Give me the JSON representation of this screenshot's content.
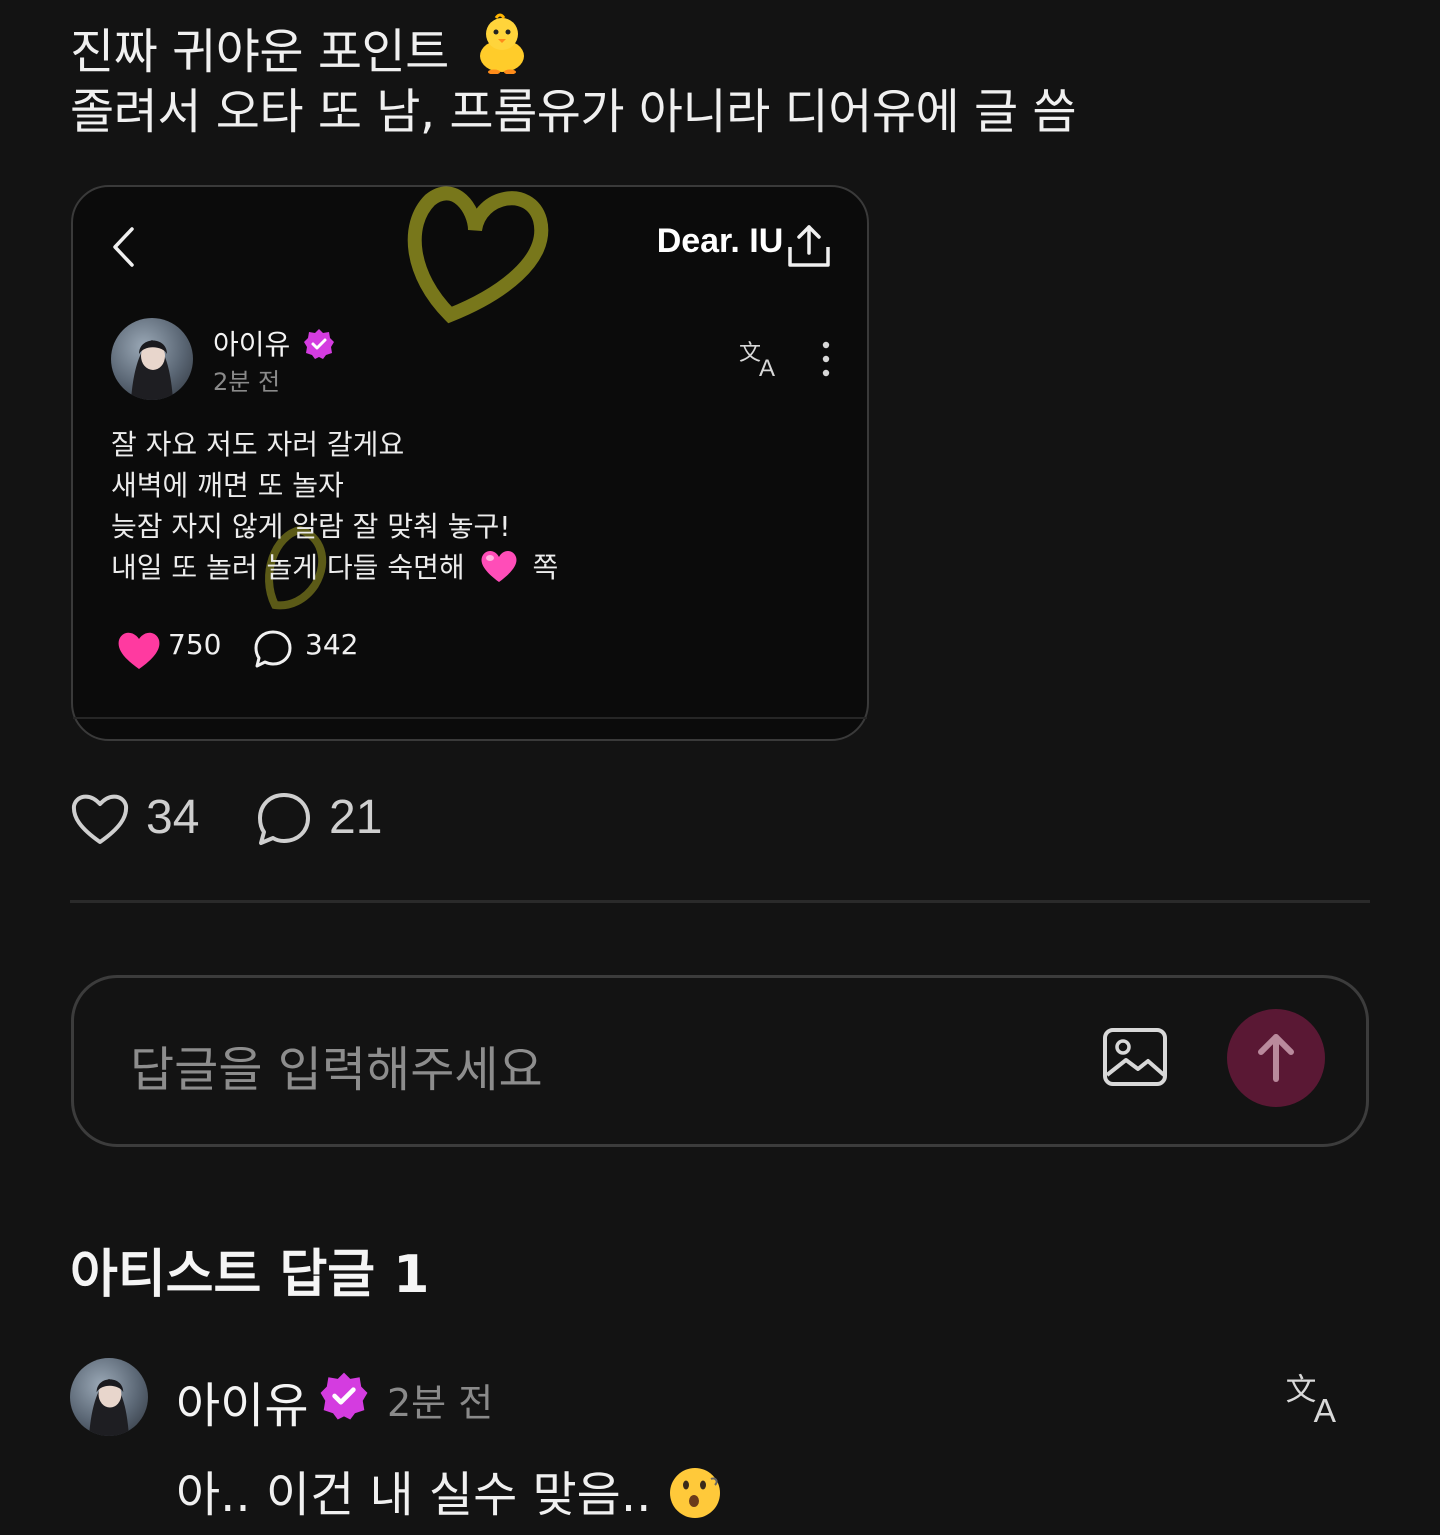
{
  "post": {
    "line1": "진짜 귀야운 포인트",
    "line2": "졸려서 오타 또 남, 프롬유가 아니라 디어유에 글 씀"
  },
  "card": {
    "title": "Dear. IU",
    "author": "아이유",
    "time": "2분 전",
    "body": [
      "잘 자요 저도 자러 갈게요",
      "새벽에 깨면 또 놀자",
      "늦잠 자지 않게 알람 잘 맞춰 놓구!",
      "내일 또 놀러 놀게 다들 숙면해"
    ],
    "body_suffix": "쪽",
    "likes": "750",
    "comments": "342"
  },
  "stats": {
    "likes": "34",
    "comments": "21"
  },
  "reply_input": {
    "placeholder": "답글을 입력해주세요"
  },
  "artist_replies": {
    "title": "아티스트 답글 1",
    "items": [
      {
        "author": "아이유",
        "time": "2분 전",
        "text": "아.. 이건 내 실수 맞음.."
      }
    ]
  },
  "colors": {
    "background": "#131313",
    "verified_badge": "#d43ce0",
    "heart": "#ff3aa0",
    "send_button": "#5a1834",
    "doodle": "#d4d22a"
  },
  "icons": {
    "back": "chevron-left-icon",
    "share": "share-icon",
    "translate": "translate-icon",
    "more": "more-vertical-icon",
    "like": "heart-icon",
    "comment": "comment-icon",
    "image": "image-icon",
    "send": "arrow-up-icon",
    "verified": "verified-badge-icon"
  }
}
